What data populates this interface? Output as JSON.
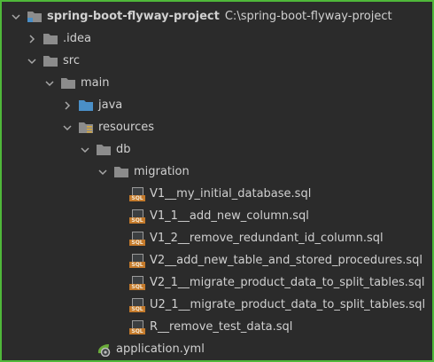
{
  "colors": {
    "background": "#2b2b2b",
    "text": "#d0d0d0",
    "folder": "#8c8c8c",
    "java_folder": "#4a8fc7",
    "sql_badge": "#c47a2b",
    "frame_border": "#4fb83a"
  },
  "tree": {
    "root": {
      "name": "spring-boot-flyway-project",
      "path": "C:\\spring-boot-flyway-project",
      "icon": "project-folder-icon",
      "expanded": true
    },
    "nodes": [
      {
        "label": ".idea",
        "icon": "folder-icon",
        "expanded": false
      },
      {
        "label": "src",
        "icon": "folder-icon",
        "expanded": true
      },
      {
        "label": "main",
        "icon": "folder-icon",
        "expanded": true
      },
      {
        "label": "java",
        "icon": "java-source-folder-icon",
        "expanded": false
      },
      {
        "label": "resources",
        "icon": "resources-folder-icon",
        "expanded": true
      },
      {
        "label": "db",
        "icon": "folder-icon",
        "expanded": true
      },
      {
        "label": "migration",
        "icon": "folder-icon",
        "expanded": true
      }
    ],
    "migration_files": [
      "V1__my_initial_database.sql",
      "V1_1__add_new_column.sql",
      "V1_2__remove_redundant_id_column.sql",
      "V2__add_new_table_and_stored_procedures.sql",
      "V2_1__migrate_product_data_to_split_tables.sql",
      "U2_1__migrate_product_data_to_split_tables.sql",
      "R__remove_test_data.sql"
    ],
    "sql_badge_text": "SQL",
    "resource_files": [
      {
        "label": "application.yml",
        "icon": "spring-yaml-config-icon"
      }
    ]
  }
}
